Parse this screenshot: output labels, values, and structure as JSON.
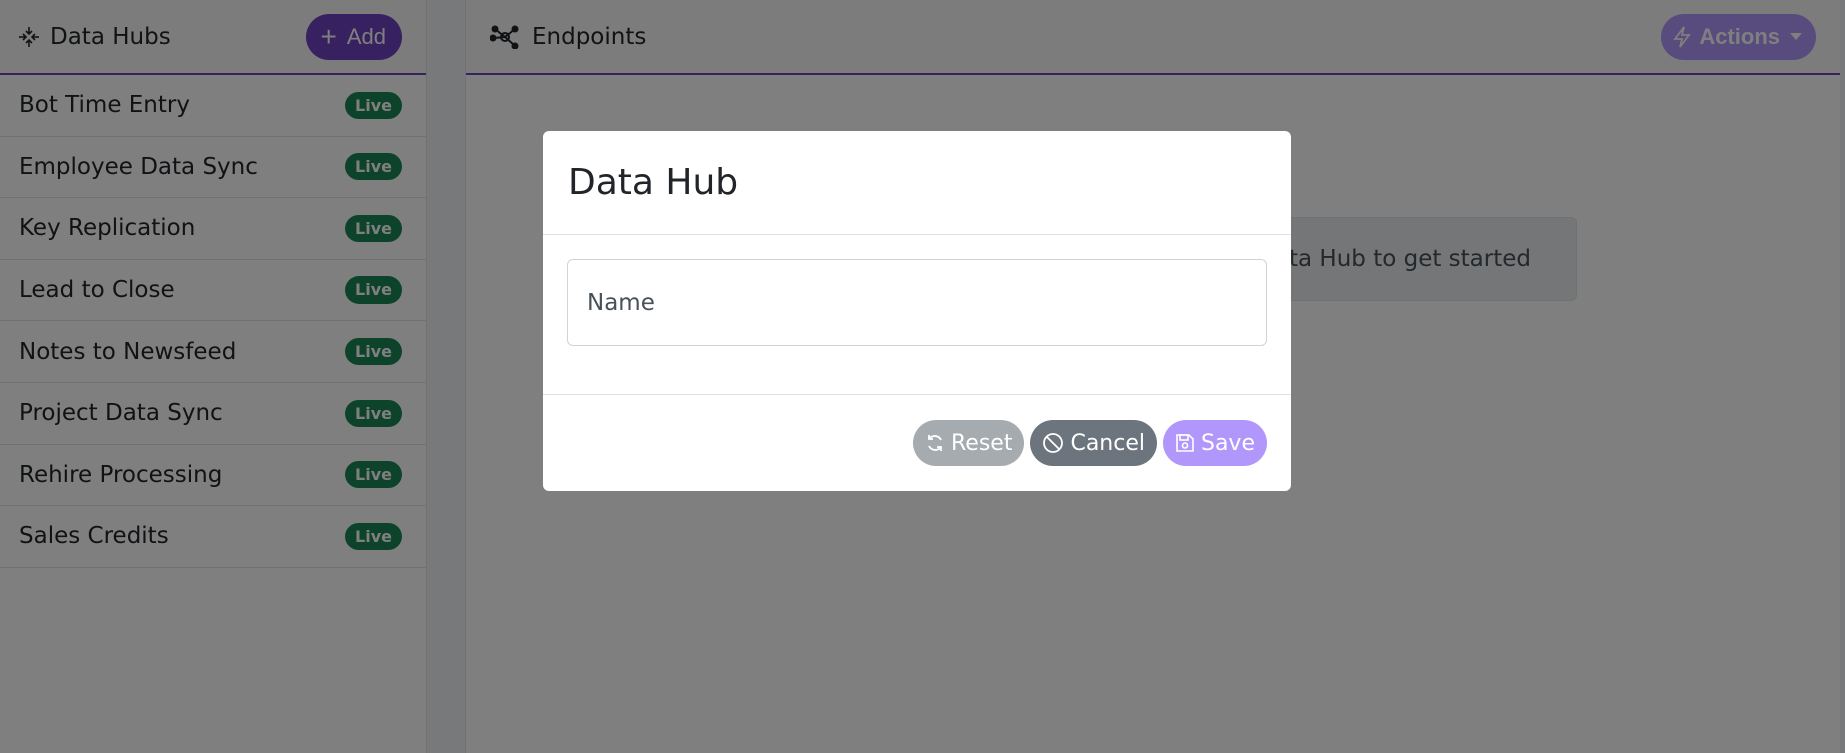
{
  "sidebar": {
    "title": "Data Hubs",
    "title_icon": "arrows-collapse-icon",
    "add_label": "Add",
    "items": [
      {
        "label": "Bot Time Entry",
        "badge": "Live"
      },
      {
        "label": "Employee Data Sync",
        "badge": "Live"
      },
      {
        "label": "Key Replication",
        "badge": "Live"
      },
      {
        "label": "Lead to Close",
        "badge": "Live"
      },
      {
        "label": "Notes to Newsfeed",
        "badge": "Live"
      },
      {
        "label": "Project Data Sync",
        "badge": "Live"
      },
      {
        "label": "Rehire Processing",
        "badge": "Live"
      },
      {
        "label": "Sales Credits",
        "badge": "Live"
      }
    ]
  },
  "main": {
    "title": "Endpoints",
    "title_icon": "network-icon",
    "actions_label": "Actions",
    "empty_text": "ata Hub to get started"
  },
  "modal": {
    "title": "Data Hub",
    "name_placeholder": "Name",
    "name_value": "",
    "reset_label": "Reset",
    "cancel_label": "Cancel",
    "save_label": "Save"
  },
  "colors": {
    "accent": "#6f42c1",
    "accent_light": "#b197fc",
    "live_badge": "#198754",
    "secondary": "#6c757d"
  }
}
